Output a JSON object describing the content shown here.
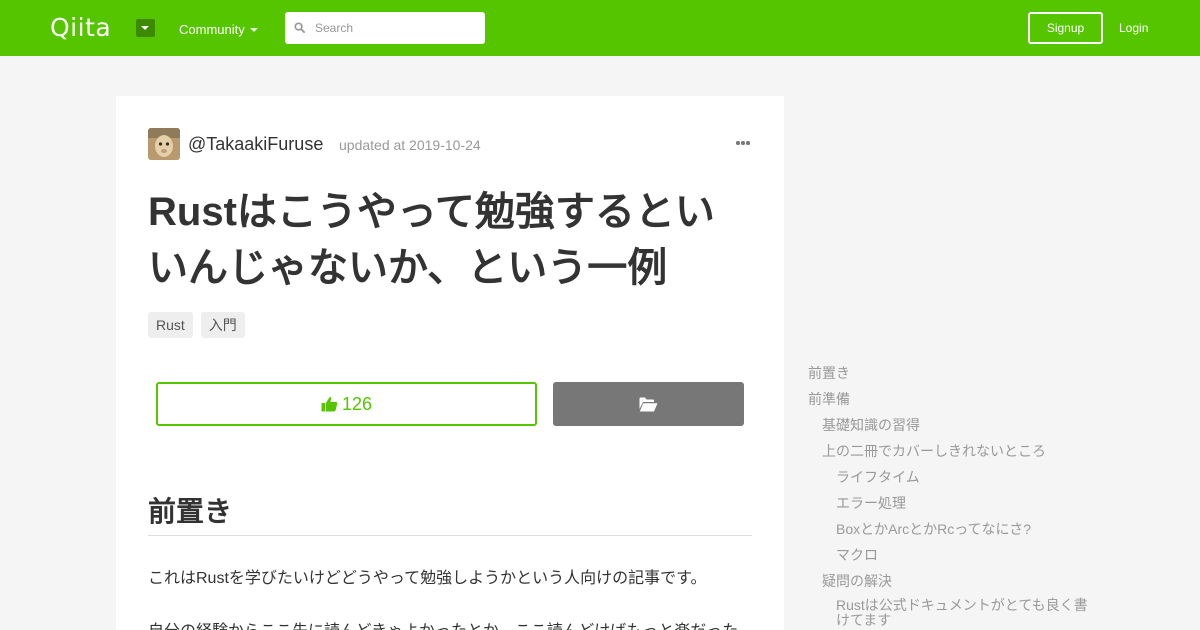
{
  "header": {
    "logo": "Qiita",
    "community_label": "Community",
    "search_placeholder": "Search",
    "signup_label": "Signup",
    "login_label": "Login",
    "brand_color": "#55c500"
  },
  "article": {
    "author": "@TakaakiFuruse",
    "updated": "updated at 2019-10-24",
    "title_line1": "Rustはこうやって勉強するとい",
    "title_line2": "いんじゃないか、という一例",
    "tags": [
      "Rust",
      "入門"
    ],
    "like_count": "126",
    "section_heading": "前置き",
    "paragraph1": "これはRustを学びたいけどどうやって勉強しようかという人向けの記事です。",
    "paragraph2": "自分の経験からここ先に読んどきゃよかったとか、ここ読んどけばもっと楽だった"
  },
  "toc": {
    "items": [
      {
        "label": "前置き",
        "level": 1
      },
      {
        "label": "前準備",
        "level": 1
      },
      {
        "label": "基礎知識の習得",
        "level": 2
      },
      {
        "label": "上の二冊でカバーしきれないところ",
        "level": 2
      },
      {
        "label": "ライフタイム",
        "level": 3
      },
      {
        "label": "エラー処理",
        "level": 3
      },
      {
        "label": "BoxとかArcとかRcってなにさ?",
        "level": 3
      },
      {
        "label": "マクロ",
        "level": 3
      },
      {
        "label": "疑問の解決",
        "level": 2
      },
      {
        "label": "Rustは公式ドキュメントがとても良く書",
        "level": 3
      },
      {
        "label": "けてます",
        "level": 3
      }
    ]
  },
  "icons": {
    "search": "search-icon",
    "like": "thumbs-up-icon",
    "stock": "folder-open-icon",
    "more": "more-dots-icon"
  }
}
